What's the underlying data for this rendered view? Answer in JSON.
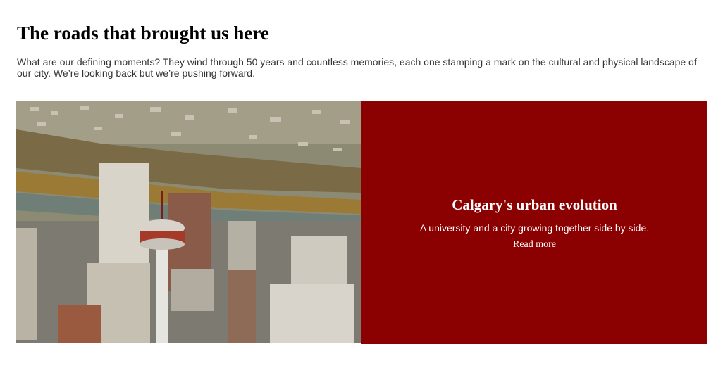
{
  "section": {
    "title": "The roads that brought us here",
    "intro": "What are our defining moments? They wind through 50 years and countless memories, each one stamping a mark on the cultural and physical landscape of our city. We’re looking back but we’re pushing forward."
  },
  "feature": {
    "image_alt": "Aerial view of downtown Calgary with the Calgary Tower and the Bow River",
    "title": "Calgary's urban evolution",
    "description": "A university and a city growing together side by side.",
    "link_label": "Read more",
    "panel_color": "#8b0000"
  }
}
